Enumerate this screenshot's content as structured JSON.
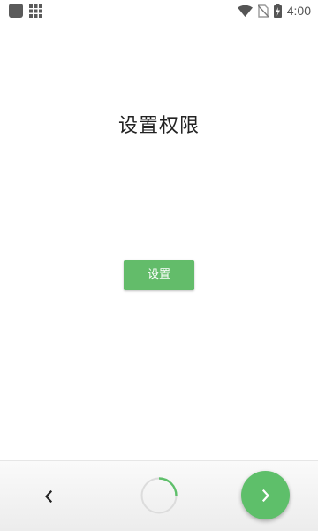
{
  "status_bar": {
    "time": "4:00",
    "icons": [
      "app-square-icon",
      "grid-icon",
      "wifi-icon",
      "no-sim-icon",
      "battery-charging-icon"
    ]
  },
  "main": {
    "title": "设置权限",
    "settings_button_label": "设置"
  },
  "bottom_bar": {
    "back_icon": "chevron-left-icon",
    "progress_icon": "loading-spinner-icon",
    "next_icon": "chevron-right-icon"
  },
  "colors": {
    "accent_green": "#63bc6a",
    "fab_green": "#5ebf6a"
  }
}
